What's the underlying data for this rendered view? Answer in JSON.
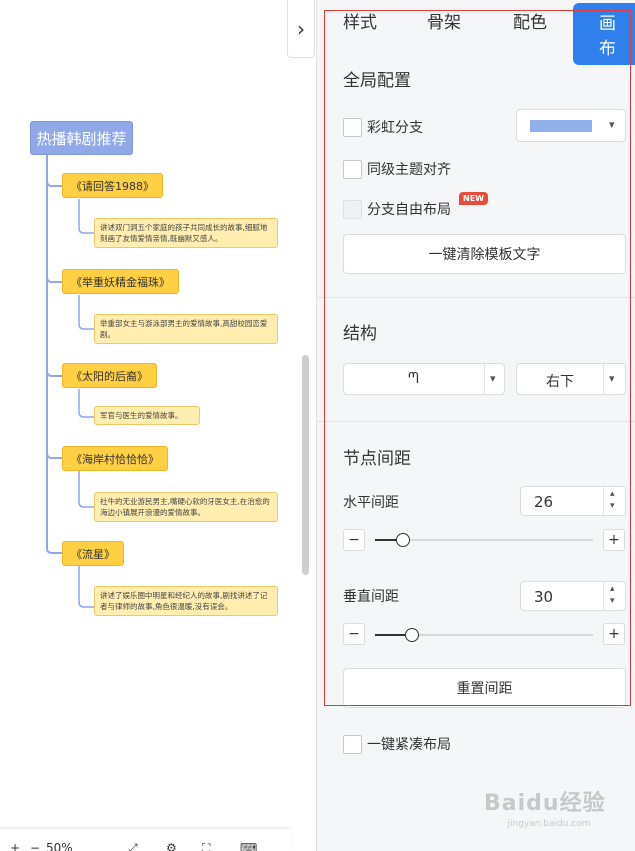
{
  "mindmap": {
    "root": "热播韩剧推荐",
    "topics": [
      {
        "title": "《请回答1988》",
        "note": "讲述双门洞五个家庭的孩子共同成长的故事,细腻地刻画了友情爱情亲情,既幽默又感人。"
      },
      {
        "title": "《举重妖精金福珠》",
        "note": "举重部女主与游泳部男主的爱情故事,高甜校园恋爱剧。"
      },
      {
        "title": "《太阳的后裔》",
        "note": "军官与医生的爱情故事。"
      },
      {
        "title": "《海岸村恰恰恰》",
        "note": "社牛的无业游民男主,嘴硬心软的牙医女主,在治愈的海边小镇展开浪漫的爱情故事。"
      },
      {
        "title": "《流星》",
        "note": "讲述了娱乐圈中明星和经纪人的故事,剧找讲述了记者与律师的故事,角色很温暖,没有误会。"
      }
    ]
  },
  "toolbar": {
    "zoom": "50%"
  },
  "panel": {
    "tabs": [
      "样式",
      "骨架",
      "配色",
      "画布"
    ],
    "active_tab": "画布",
    "global_title": "全局配置",
    "rainbow_branch": "彩虹分支",
    "align_siblings": "同级主题对齐",
    "free_layout": "分支自由布局",
    "new_badge": "NEW",
    "clear_template_btn": "一键清除模板文字",
    "structure_title": "结构",
    "structure_icon": "ᘉ",
    "structure_direction": "右下",
    "spacing_title": "节点间距",
    "horizontal_label": "水平间距",
    "horizontal_value": "26",
    "vertical_label": "垂直间距",
    "vertical_value": "30",
    "reset_spacing_btn": "重置间距",
    "compact_layout": "一键紧凑布局",
    "branch_color": "#90b0ec",
    "active_color": "#2f80ed",
    "horizontal_slider_fraction": 0.13,
    "vertical_slider_fraction": 0.17
  },
  "watermark": {
    "logo": "Baidu经验",
    "url": "jingyan.baidu.com"
  }
}
